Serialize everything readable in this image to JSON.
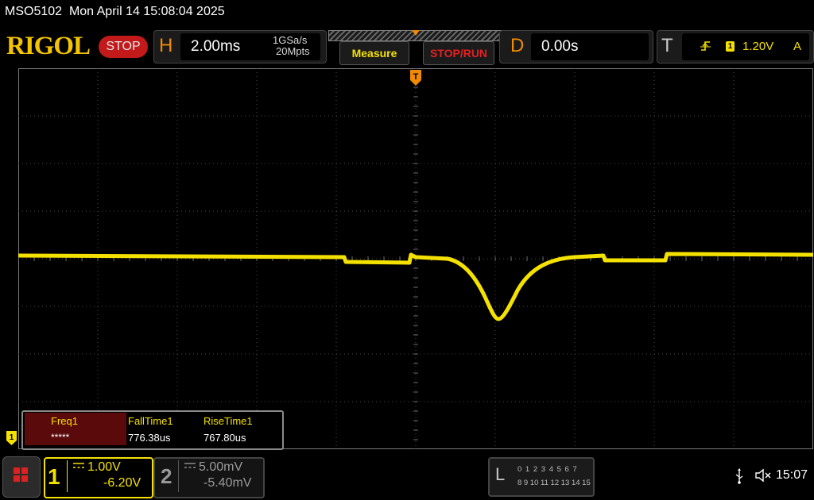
{
  "titlebar": {
    "model": "MSO5102",
    "datetime": "Mon April 14 15:08:04 2025"
  },
  "header": {
    "logo": "RIGOL",
    "run_state": "STOP",
    "horizontal": {
      "letter": "H",
      "timebase": "2.00ms",
      "sample_rate": "1GSa/s",
      "memory_depth": "20Mpts"
    },
    "measure_label": "Measure",
    "stoprun_label": "STOP/RUN",
    "delay": {
      "letter": "D",
      "value": "0.00s"
    },
    "trigger": {
      "letter": "T",
      "source": "1",
      "level": "1.20V",
      "mode": "A"
    }
  },
  "trigger_marker": "T",
  "measurements": [
    {
      "label": "Freq1",
      "value": "*****"
    },
    {
      "label": "FallTime1",
      "value": "776.38us"
    },
    {
      "label": "RiseTime1",
      "value": "767.80us"
    }
  ],
  "ch1_marker": "1",
  "channels": {
    "ch1": {
      "number": "1",
      "scale": "1.00V",
      "offset": "-6.20V"
    },
    "ch2": {
      "number": "2",
      "scale": "5.00mV",
      "offset": "-5.40mV"
    }
  },
  "logic_analyzer": {
    "letter": "L",
    "row1": "0 1 2 3  4 5 6 7",
    "row2": "8 9 10 11 12 13 14 15"
  },
  "status": {
    "clock": "15:07"
  },
  "colors": {
    "ch1": "#f5e100",
    "accent_orange": "#f08a00",
    "stop_red": "#c21a1a",
    "grid": "#4a4a4a"
  },
  "icons": [
    "menu-grid-icon",
    "usb-icon",
    "speaker-muted-icon",
    "trigger-rising-edge-icon",
    "trigger-position-icon"
  ]
}
